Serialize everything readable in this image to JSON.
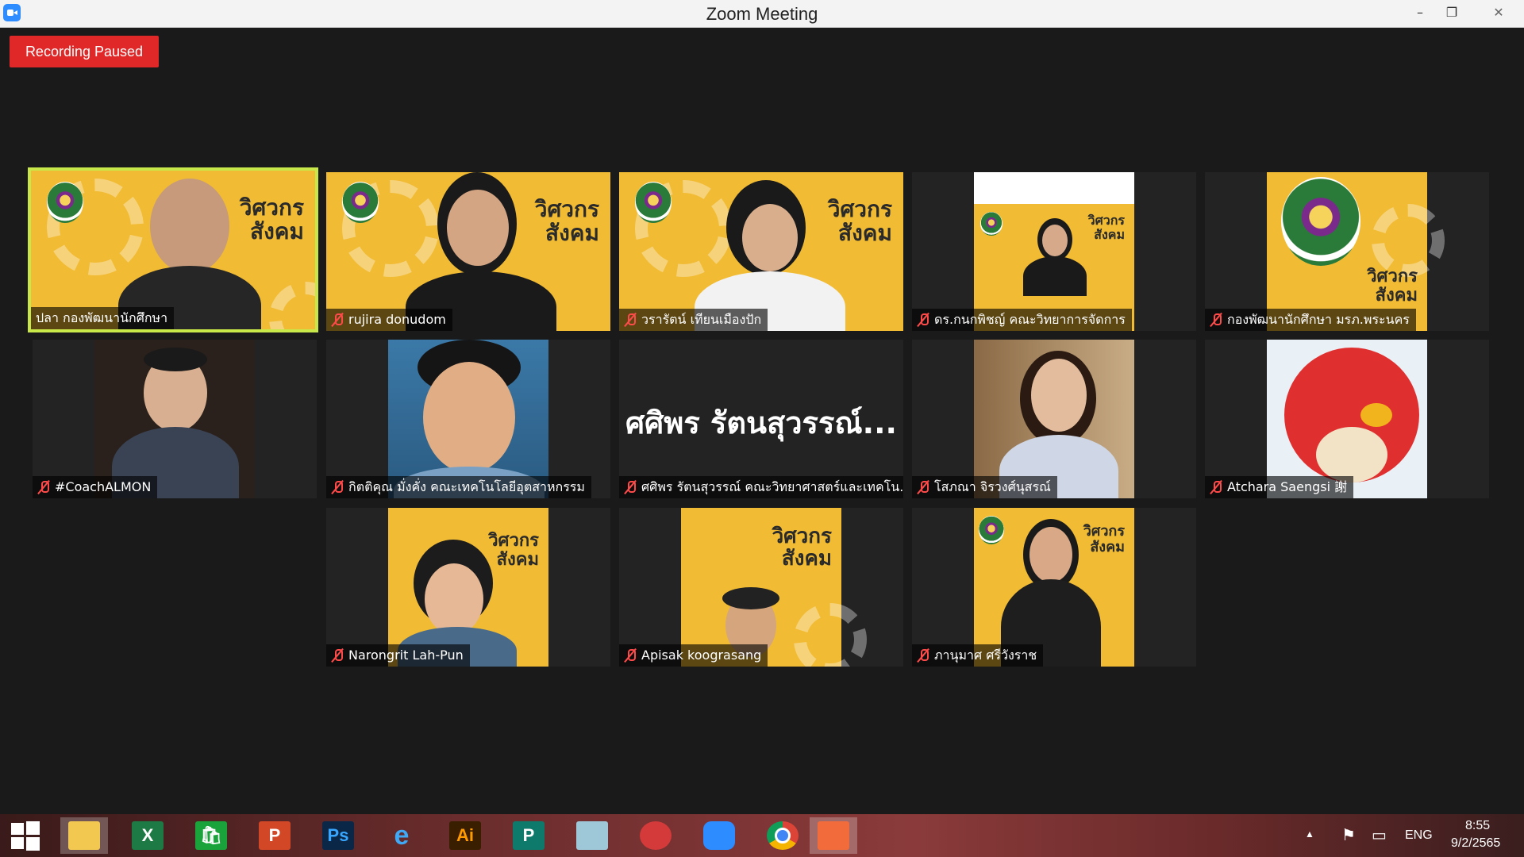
{
  "window": {
    "title": "Zoom Meeting",
    "minimize": "–",
    "restore": "❐",
    "close": "✕"
  },
  "recording": {
    "label": "Recording Paused"
  },
  "big_name_text": "ศศิพร รัตนสุวรรณ์...",
  "banner_lines": [
    "วิศวกร",
    "สังคม"
  ],
  "participants": [
    {
      "name": "ปลา กองพัฒนานักศึกษา",
      "muted": false
    },
    {
      "name": "rujira donudom",
      "muted": true
    },
    {
      "name": "วรารัตน์ เทียนเมืองปัก",
      "muted": true
    },
    {
      "name": "ดร.กนกพิชญ์ คณะวิทยาการจัดการ",
      "muted": true
    },
    {
      "name": "กองพัฒนานักศึกษา มรภ.พระนคร",
      "muted": true
    },
    {
      "name": "#CoachALMON",
      "muted": true
    },
    {
      "name": "กิตติคุณ มั่งคั่ง คณะเทคโนโลยีอุตสาหกรรม",
      "muted": true
    },
    {
      "name": "ศศิพร รัตนสุวรรณ์ คณะวิทยาศาสตร์และเทคโน...",
      "muted": true
    },
    {
      "name": "โสภณา จิรวงศ์นุสรณ์",
      "muted": true
    },
    {
      "name": "Atchara Saengsi 謝",
      "muted": true
    },
    {
      "name": "Narongrit Lah-Pun",
      "muted": true
    },
    {
      "name": "Apisak koograsang",
      "muted": true
    },
    {
      "name": "ภานุมาศ ศรีวังราช",
      "muted": true
    }
  ],
  "taskbar": {
    "apps": [
      "start",
      "file-explorer",
      "excel",
      "store",
      "powerpoint",
      "photoshop",
      "internet-explorer",
      "illustrator",
      "publisher",
      "notepad",
      "photoscape",
      "zoom",
      "chrome",
      "presenter"
    ],
    "labels": {
      "excel": "X",
      "store": "🛍",
      "powerpoint": "P",
      "photoshop": "Ps",
      "ie": "e",
      "illustrator": "Ai",
      "publisher": "P"
    },
    "lang": "ENG",
    "time": "8:55",
    "date": "9/2/2565"
  },
  "colors": {
    "active_outline": "#c8e84a",
    "recording_bg": "#e02828",
    "banner_yellow": "#f1bb34"
  }
}
